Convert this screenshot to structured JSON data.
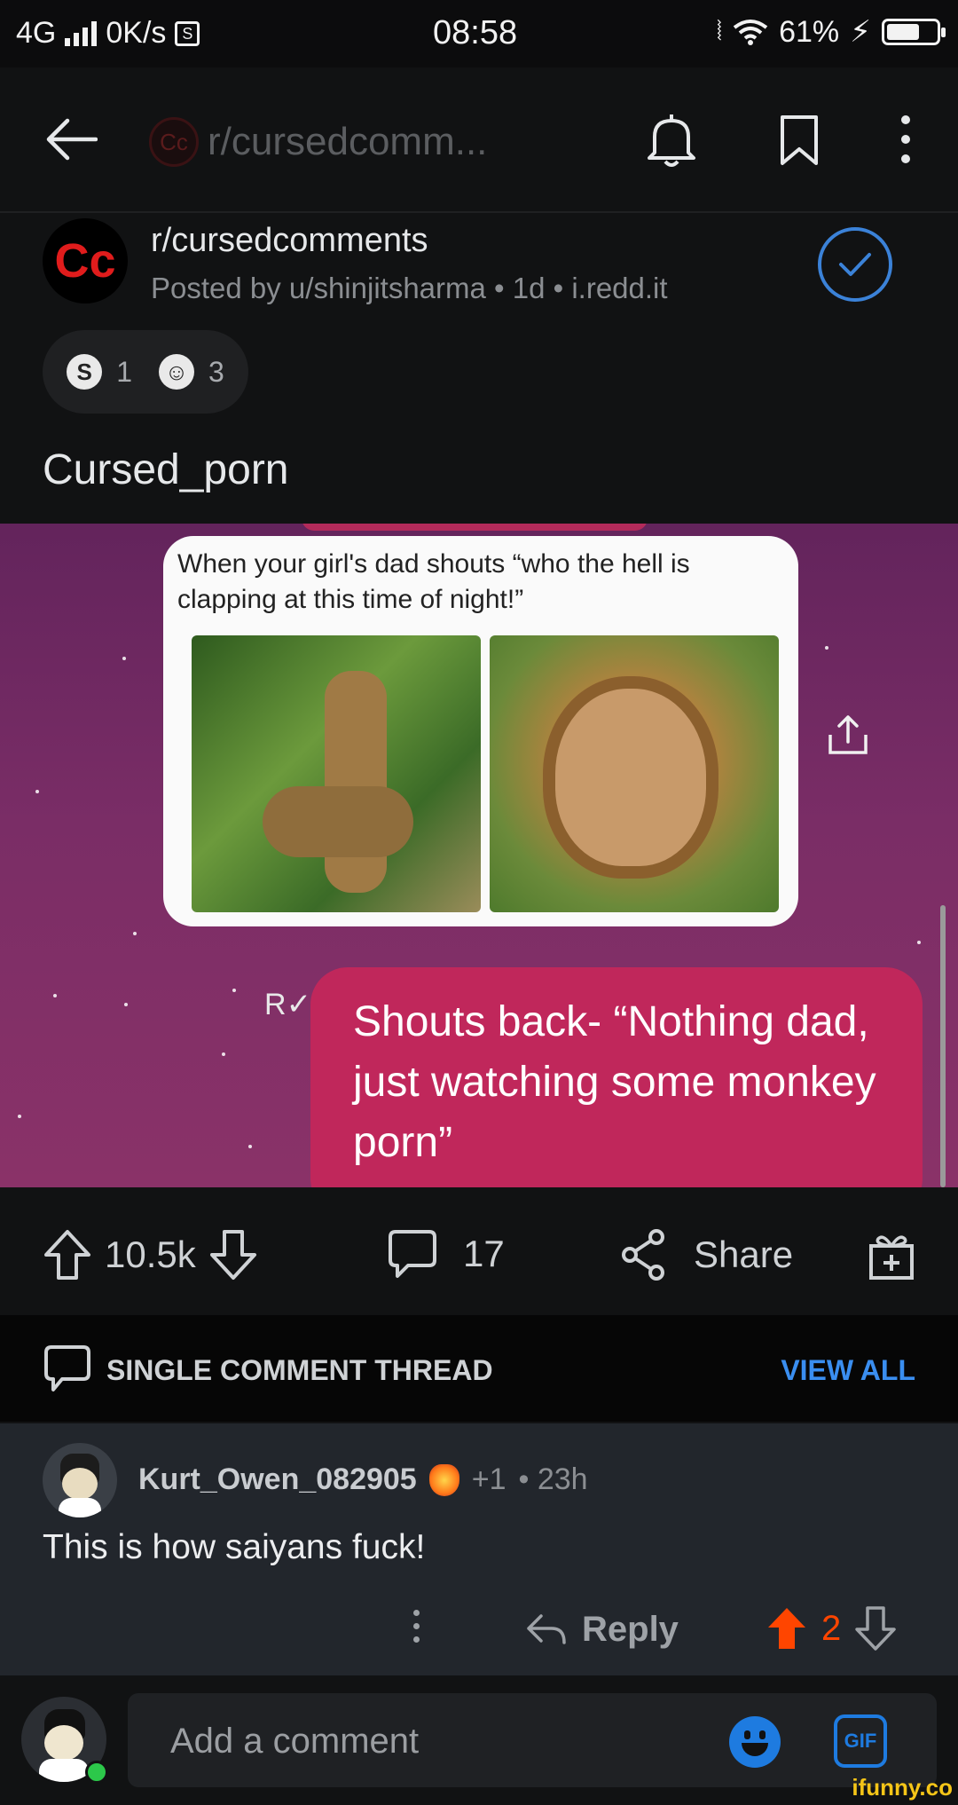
{
  "status_bar": {
    "network": "4G",
    "speed": "0K/s",
    "time": "08:58",
    "battery": "61%"
  },
  "header": {
    "title": "r/cursedcomm...",
    "subreddit_avatar_text": "Cc"
  },
  "post": {
    "subreddit": "r/cursedcomments",
    "meta": "Posted by u/shinjitsharma • 1d • i.redd.it",
    "avatar_text": "Cc",
    "awards": [
      {
        "icon": "silver-award-icon",
        "symbol": "S",
        "count": "1"
      },
      {
        "icon": "wholesome-award-icon",
        "symbol": "☺",
        "count": "3"
      }
    ],
    "title": "Cursed_porn"
  },
  "image": {
    "caption": "When your girl's dad shouts “who the hell is clapping at this time of night!”",
    "reply_bubble": "Shouts back- “Nothing dad, just watching some monkey porn”",
    "read_mark": "R"
  },
  "actions": {
    "votes": "10.5k",
    "comments": "17",
    "share": "Share"
  },
  "thread": {
    "label": "SINGLE COMMENT THREAD",
    "view_all": "VIEW ALL"
  },
  "comment": {
    "username": "Kurt_Owen_082905",
    "award_count": "+1",
    "age": "• 23h",
    "text": "This is how saiyans fuck!",
    "reply": "Reply",
    "score": "2"
  },
  "composer": {
    "placeholder": "Add a comment",
    "gif": "GIF"
  },
  "watermark": "ifunny.co",
  "colors": {
    "accent_blue": "#3a8ef0",
    "upvote_orange": "#ff4500",
    "bubble_pink": "#c0275b"
  }
}
